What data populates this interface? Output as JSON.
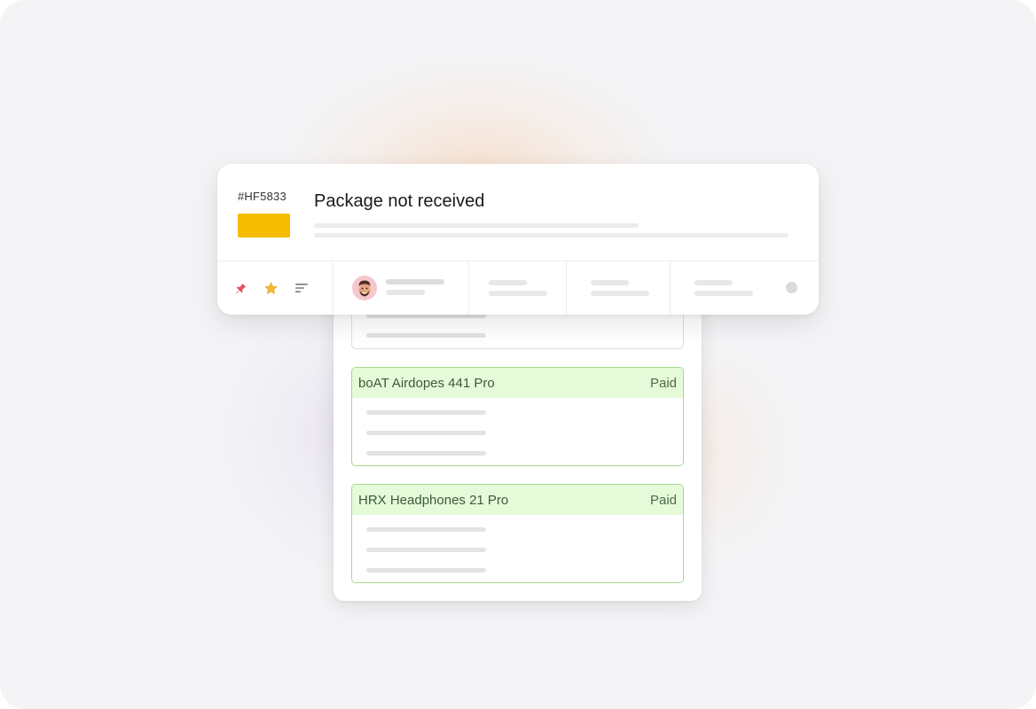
{
  "ticket": {
    "id": "#HF5833",
    "title": "Package not received",
    "tag_color": "#F6BD00"
  },
  "toolbar": {
    "icons": [
      "pin-icon",
      "star-icon",
      "sort-icon"
    ],
    "pin_color": "#E8505B",
    "star_color": "#F4B73A"
  },
  "order_items": [
    {
      "name": "boAT Airdopes 441 Pro",
      "status": "Paid"
    },
    {
      "name": "HRX Headphones 21 Pro",
      "status": "Paid"
    }
  ],
  "colors": {
    "paid_header_bg": "#E4FAD8",
    "paid_border": "#A6D98F",
    "paid_text": "#3E5A3A"
  }
}
